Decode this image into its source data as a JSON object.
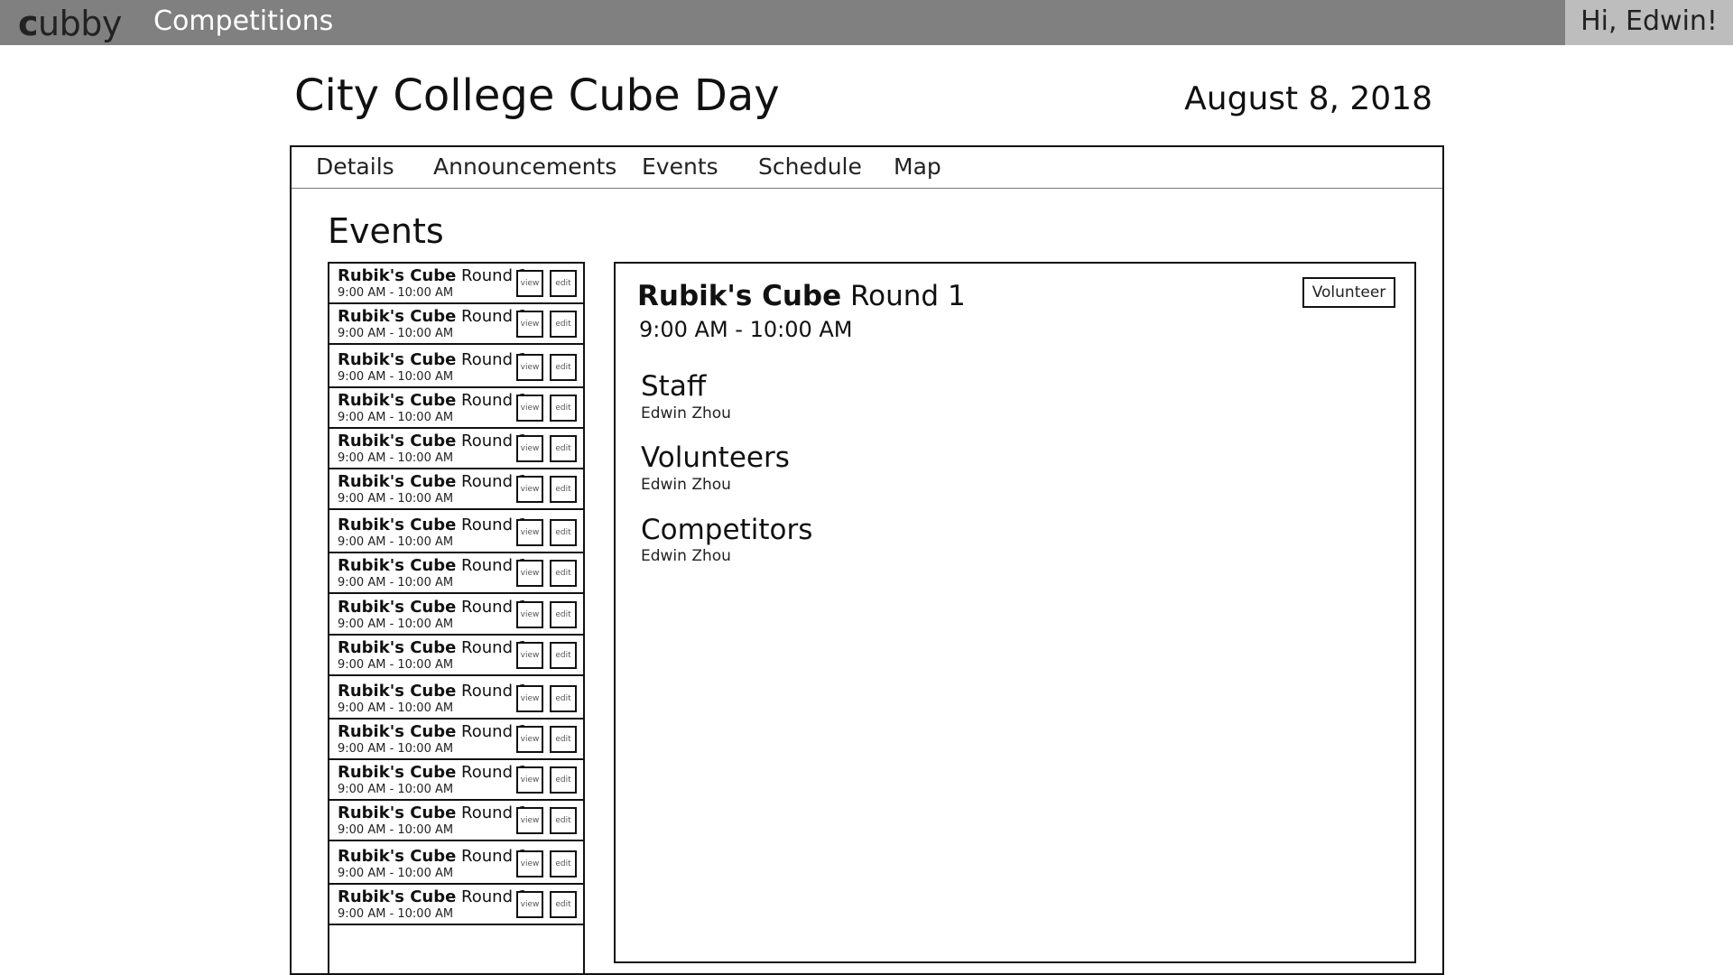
{
  "topbar": {
    "logo_c": "c",
    "logo_rest": "ubby",
    "nav_competitions": "Competitions",
    "greeting": "Hi, Edwin!"
  },
  "page": {
    "title": "City College Cube Day",
    "date": "August 8, 2018"
  },
  "tabs": [
    {
      "label": "Details"
    },
    {
      "label": "Announcements"
    },
    {
      "label": "Events"
    },
    {
      "label": "Schedule"
    },
    {
      "label": "Map"
    }
  ],
  "section_heading": "Events",
  "event_list": {
    "view_label": "view",
    "edit_label": "edit",
    "items": [
      {
        "name_bold": "Rubik's Cube",
        "round": "Round 1",
        "time": "9:00 AM - 10:00 AM"
      },
      {
        "name_bold": "Rubik's Cube",
        "round": "Round 1",
        "time": "9:00 AM - 10:00 AM"
      },
      {
        "name_bold": "Rubik's Cube",
        "round": "Round 1",
        "time": "9:00 AM - 10:00 AM"
      },
      {
        "name_bold": "Rubik's Cube",
        "round": "Round 1",
        "time": "9:00 AM - 10:00 AM"
      },
      {
        "name_bold": "Rubik's Cube",
        "round": "Round 1",
        "time": "9:00 AM - 10:00 AM"
      },
      {
        "name_bold": "Rubik's Cube",
        "round": "Round 1",
        "time": "9:00 AM - 10:00 AM"
      },
      {
        "name_bold": "Rubik's Cube",
        "round": "Round 1",
        "time": "9:00 AM - 10:00 AM"
      },
      {
        "name_bold": "Rubik's Cube",
        "round": "Round 1",
        "time": "9:00 AM - 10:00 AM"
      },
      {
        "name_bold": "Rubik's Cube",
        "round": "Round 1",
        "time": "9:00 AM - 10:00 AM"
      },
      {
        "name_bold": "Rubik's Cube",
        "round": "Round 1",
        "time": "9:00 AM - 10:00 AM"
      },
      {
        "name_bold": "Rubik's Cube",
        "round": "Round 1",
        "time": "9:00 AM - 10:00 AM"
      },
      {
        "name_bold": "Rubik's Cube",
        "round": "Round 1",
        "time": "9:00 AM - 10:00 AM"
      },
      {
        "name_bold": "Rubik's Cube",
        "round": "Round 1",
        "time": "9:00 AM - 10:00 AM"
      },
      {
        "name_bold": "Rubik's Cube",
        "round": "Round 1",
        "time": "9:00 AM - 10:00 AM"
      },
      {
        "name_bold": "Rubik's Cube",
        "round": "Round 1",
        "time": "9:00 AM - 10:00 AM"
      },
      {
        "name_bold": "Rubik's Cube",
        "round": "Round 1",
        "time": "9:00 AM - 10:00 AM"
      }
    ]
  },
  "detail": {
    "name_bold": "Rubik's Cube",
    "round": "Round 1",
    "time": "9:00 AM - 10:00 AM",
    "volunteer_label": "Volunteer",
    "groups": [
      {
        "heading": "Staff",
        "member": "Edwin Zhou"
      },
      {
        "heading": "Volunteers",
        "member": "Edwin Zhou"
      },
      {
        "heading": "Competitors",
        "member": "Edwin Zhou"
      }
    ]
  }
}
